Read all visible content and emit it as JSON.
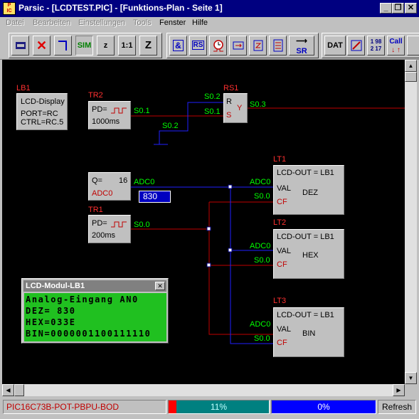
{
  "window": {
    "title": "Parsic - [LCDTEST.PIC] - [Funktions-Plan - Seite 1]",
    "icon_text": "PARSIC",
    "btn_minimize": "_",
    "btn_restore": "❐",
    "btn_close": "✕"
  },
  "menu": [
    {
      "label": "Datei",
      "enabled": false
    },
    {
      "label": "Bearbeiten",
      "enabled": false
    },
    {
      "label": "Einstellungen",
      "enabled": false
    },
    {
      "label": "Tools",
      "enabled": false
    },
    {
      "label": "Fenster",
      "enabled": true
    },
    {
      "label": "Hilfe",
      "enabled": true
    }
  ],
  "toolbar": {
    "group1": [
      "chip-icon",
      "delete-icon",
      "wire-icon",
      "SIM",
      "z",
      "1:1",
      "Z"
    ],
    "sim": "SIM",
    "z_small": "z",
    "one_to_one": "1:1",
    "z_big": "Z",
    "and": "&",
    "rs": "RS",
    "sr": "SR",
    "dat": "DAT",
    "call": "Call",
    "counter_a": "1 98",
    "counter_b": "2 17"
  },
  "blocks": {
    "lb1": {
      "label": "LB1",
      "line1": "LCD-Display",
      "line2": "PORT=RC",
      "line3": "CTRL=RC.5"
    },
    "tr2": {
      "label": "TR2",
      "pd": "PD=",
      "time": "1000ms",
      "out": "S0.1"
    },
    "rs1": {
      "label": "RS1",
      "r": "R",
      "s": "S",
      "y": "Y",
      "in_r": "S0.2",
      "in_s": "S0.1",
      "out": "S0.3"
    },
    "s02": "S0.2",
    "adc": {
      "q": "Q=",
      "q_val": "16",
      "name": "ADC0",
      "out": "ADC0",
      "display": "830"
    },
    "tr1": {
      "label": "TR1",
      "pd": "PD=",
      "time": "200ms",
      "out": "S0.0"
    },
    "lt1": {
      "label": "LT1",
      "title": "LCD-OUT = LB1",
      "val": "VAL",
      "cf": "CF",
      "mode": "DEZ",
      "in_val": "ADC0",
      "in_cf": "S0.0"
    },
    "lt2": {
      "label": "LT2",
      "title": "LCD-OUT = LB1",
      "val": "VAL",
      "cf": "CF",
      "mode": "HEX",
      "in_val": "ADC0",
      "in_cf": "S0.0"
    },
    "lt3": {
      "label": "LT3",
      "title": "LCD-OUT = LB1",
      "val": "VAL",
      "cf": "CF",
      "mode": "BIN",
      "in_val": "ADC0",
      "in_cf": "S0.0"
    }
  },
  "lcd_module": {
    "title": "LCD-Modul-LB1",
    "close": "✕",
    "rows": [
      "Analog-Eingang AN0",
      "DEZ=   830",
      "HEX=033E",
      "BIN=0000001100111110"
    ]
  },
  "status": {
    "device": "PIC16C73B-POT-PBPU-BOD",
    "progress1": "11%",
    "progress1_value": 0.11,
    "progress2": "0%",
    "refresh": "Refresh"
  },
  "colors": {
    "wire_red": "#c00000",
    "wire_blue": "#2020ff",
    "label_green": "#00ff00",
    "label_red": "#ff3030"
  }
}
